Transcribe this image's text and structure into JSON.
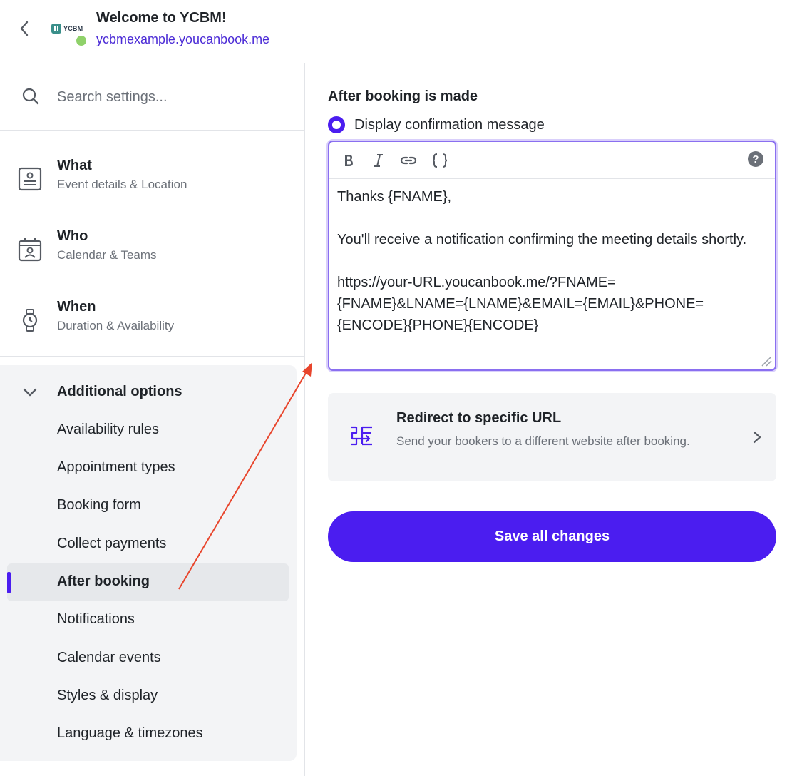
{
  "header": {
    "title": "Welcome to YCBM!",
    "link": "ycbmexample.youcanbook.me",
    "logo_text": "YCBM",
    "status_color": "#8fd16a"
  },
  "sidebar": {
    "search_placeholder": "Search settings...",
    "sections": [
      {
        "title": "What",
        "subtitle": "Event details & Location",
        "icon": "id-card-icon"
      },
      {
        "title": "Who",
        "subtitle": "Calendar & Teams",
        "icon": "calendar-person-icon"
      },
      {
        "title": "When",
        "subtitle": "Duration & Availability",
        "icon": "watch-icon"
      }
    ],
    "additional": {
      "title": "Additional options",
      "items": [
        "Availability rules",
        "Appointment types",
        "Booking form",
        "Collect payments",
        "After booking",
        "Notifications",
        "Calendar events",
        "Styles & display",
        "Language & timezones"
      ],
      "active_item": "After booking"
    }
  },
  "main": {
    "section_title": "After booking is made",
    "radio_label": "Display confirmation message",
    "editor": {
      "toolbar": [
        "bold-icon",
        "italic-icon",
        "link-icon",
        "braces-icon"
      ],
      "help": "?",
      "content": "Thanks {FNAME},\n\nYou'll receive a notification confirming the meeting details shortly.\n\nhttps://your-URL.youcanbook.me/?FNAME=\n{FNAME}&LNAME={LNAME}&EMAIL={EMAIL}&PHONE=\n{ENCODE}{PHONE}{ENCODE}"
    },
    "redirect": {
      "title": "Redirect to specific URL",
      "description": "Send your bookers to a different website after booking."
    },
    "save_label": "Save all changes"
  },
  "colors": {
    "accent": "#4b1df0",
    "link": "#4b2bd6",
    "annotation": "#e8452c"
  }
}
